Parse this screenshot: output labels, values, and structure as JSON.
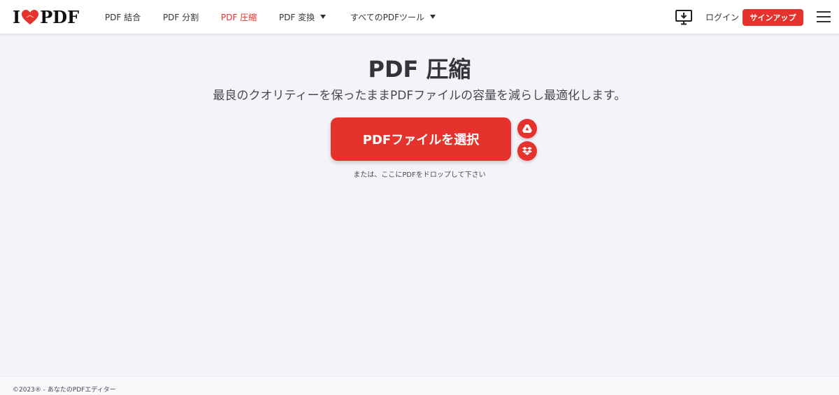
{
  "header": {
    "logo_left": "I",
    "logo_right": "PDF",
    "nav": [
      {
        "label": "PDF 結合"
      },
      {
        "label": "PDF 分割"
      },
      {
        "label": "PDF 圧縮"
      },
      {
        "label": "PDF 変換"
      },
      {
        "label": "すべてのPDFツール"
      }
    ],
    "login_label": "ログイン",
    "signup_label": "サインアップ"
  },
  "main": {
    "title": "PDF 圧縮",
    "subtitle": "最良のクオリティーを保ったままPDFファイルの容量を減らし最適化します。",
    "select_button": "PDFファイルを選択",
    "drop_hint": "または、ここにPDFをドロップして下さい"
  },
  "footer": {
    "text": "©2023® - あなたのPDFエディター"
  },
  "colors": {
    "accent": "#e5322d",
    "background": "#f4f4f8",
    "header_bg": "#ffffff"
  },
  "icons": [
    "heart-icon",
    "caret-down-icon",
    "desktop-download-icon",
    "hamburger-menu-icon",
    "google-drive-icon",
    "dropbox-icon"
  ]
}
